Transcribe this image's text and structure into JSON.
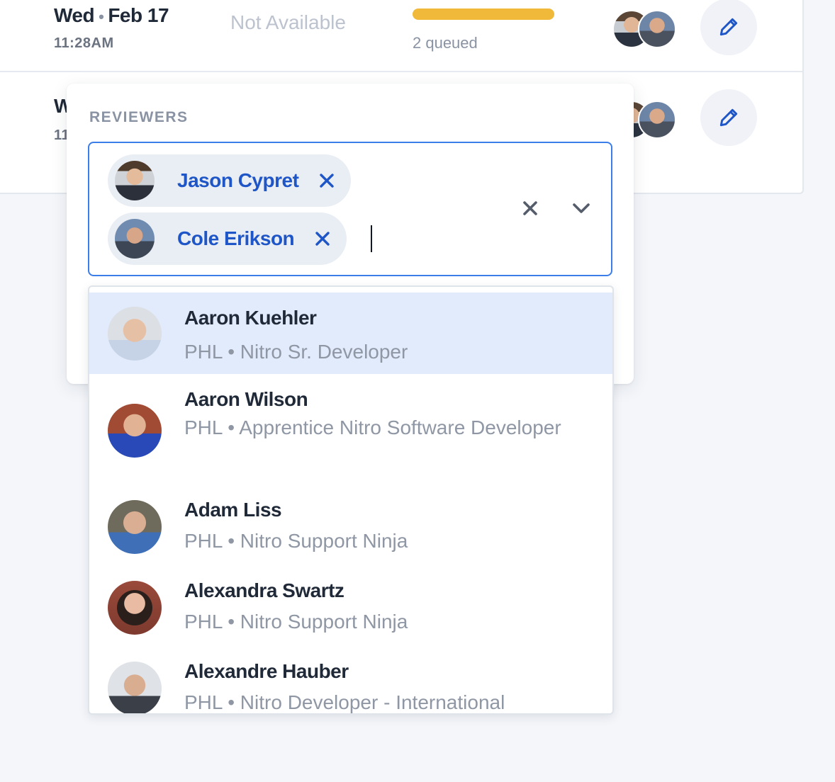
{
  "rows": [
    {
      "day": "Wed",
      "date": "Feb 17",
      "time": "11:28AM",
      "status": "Not Available",
      "queued_label": "2 queued",
      "progress": 1.0
    },
    {
      "day": "W",
      "time": "11"
    }
  ],
  "reviewers": {
    "label": "REVIEWERS",
    "selected": [
      {
        "name": "Jason Cypret"
      },
      {
        "name": "Cole Erikson"
      }
    ],
    "options": [
      {
        "name": "Aaron Kuehler",
        "subtitle": "PHL • Nitro Sr. Developer",
        "highlighted": true
      },
      {
        "name": "Aaron Wilson",
        "subtitle": "PHL • Apprentice Nitro Software Developer"
      },
      {
        "name": "Adam Liss",
        "subtitle": "PHL • Nitro Support Ninja"
      },
      {
        "name": "Alexandra Swartz",
        "subtitle": "PHL • Nitro Support Ninja"
      },
      {
        "name": "Alexandre Hauber",
        "subtitle": "PHL • Nitro Developer - International"
      }
    ]
  },
  "icons": {
    "edit": "pencil-icon",
    "chip_remove": "close-icon",
    "clear": "close-icon",
    "open": "chevron-down-icon"
  },
  "colors": {
    "accent": "#1f56c7",
    "focus_border": "#3b7de9",
    "progress": "#f0b93a",
    "highlight": "#e2ebfb",
    "muted_text": "#8f97a5"
  }
}
